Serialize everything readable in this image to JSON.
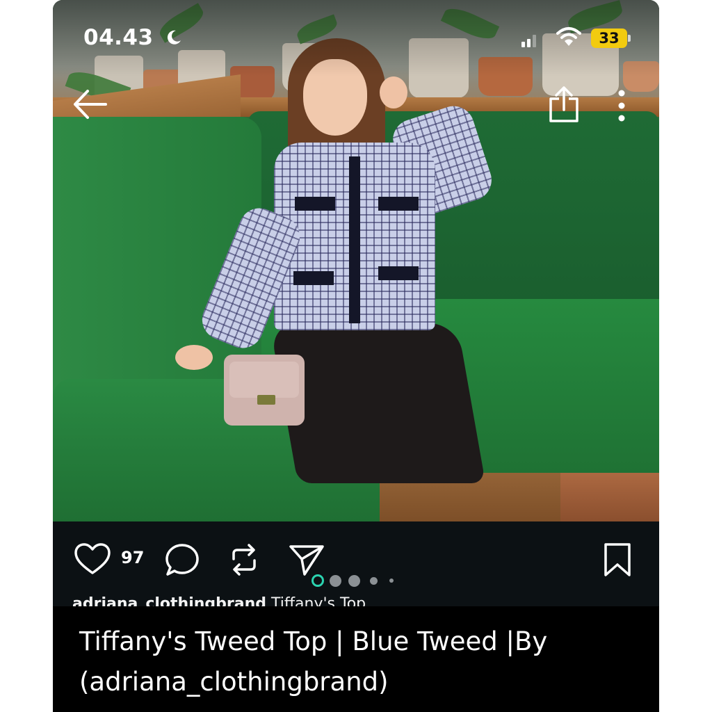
{
  "status_bar": {
    "time": "04.43",
    "battery": "33",
    "icons": [
      "moon-icon",
      "signal-icon",
      "wifi-icon",
      "battery-icon"
    ],
    "battery_color": "#f2cb0f"
  },
  "header": {
    "back_icon": "arrow-left-icon",
    "share_icon": "share-icon",
    "more_icon": "more-vertical-icon"
  },
  "actions": {
    "like_count": "97",
    "icons": [
      "heart-icon",
      "comment-icon",
      "repost-icon",
      "send-icon",
      "bookmark-icon"
    ],
    "carousel": {
      "count": 5,
      "active_index": 0,
      "active_color": "#2bd3b0"
    },
    "username_peek": "adriana_clothingbrand",
    "caption_peek": " Tiffany's Top"
  },
  "caption": {
    "line1": "Tiffany's Tweed Top | Blue Tweed |By",
    "line2": "(adriana_clothingbrand)"
  }
}
